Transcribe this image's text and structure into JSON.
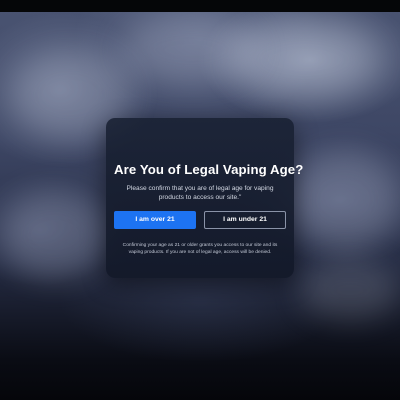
{
  "age_gate": {
    "title": "Are You of Legal Vaping Age?",
    "description": "Please confirm that you are of legal age for vaping products to access our site.\"",
    "over_button_label": "I am over 21",
    "under_button_label": "I am under 21",
    "disclaimer": "Confirming your age as 21 or older grants you access to our site and its vaping products. If you are not of legal age, access will be denied."
  },
  "colors": {
    "primary_button": "#1d73f2",
    "modal_background": "#161e30",
    "secondary_button_border": "#8a93a8"
  }
}
